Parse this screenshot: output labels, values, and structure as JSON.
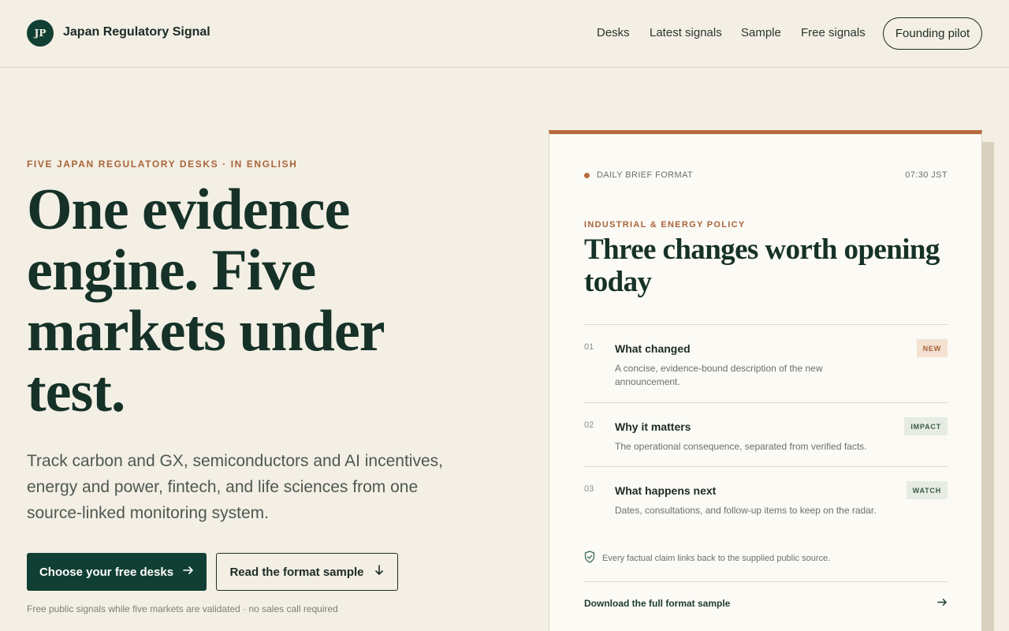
{
  "header": {
    "logo_initials": "JP",
    "brand": "Japan Regulatory Signal",
    "nav": [
      "Desks",
      "Latest signals",
      "Sample",
      "Free signals"
    ],
    "cta": "Founding pilot"
  },
  "hero": {
    "eyebrow": "FIVE JAPAN REGULATORY DESKS · IN ENGLISH",
    "headline": "One evidence engine. Five markets under test.",
    "subtext": "Track carbon and GX, semiconductors and AI incentives, energy and power, fintech, and life sciences from one source-linked monitoring system.",
    "primary_button": "Choose your free desks",
    "secondary_button": "Read the format sample",
    "footnote": "Free public signals while five markets are validated · no sales call required"
  },
  "card": {
    "label": "DAILY BRIEF FORMAT",
    "time": "07:30 JST",
    "eyebrow": "INDUSTRIAL & ENERGY POLICY",
    "title": "Three changes worth opening today",
    "rows": [
      {
        "num": "01",
        "title": "What changed",
        "desc": "A concise, evidence-bound description of the new announcement.",
        "tag": "NEW"
      },
      {
        "num": "02",
        "title": "Why it matters",
        "desc": "The operational consequence, separated from verified facts.",
        "tag": "IMPACT"
      },
      {
        "num": "03",
        "title": "What happens next",
        "desc": "Dates, consultations, and follow-up items to keep on the radar.",
        "tag": "WATCH"
      }
    ],
    "verify_note": "Every factual claim links back to the supplied public source.",
    "download_link": "Download the full format sample"
  },
  "colors": {
    "background": "#f3efe4",
    "brand_green": "#123f33",
    "accent_copper": "#b86a3a"
  },
  "icons": [
    "arrow-right-icon",
    "arrow-down-icon",
    "shield-check-icon"
  ]
}
